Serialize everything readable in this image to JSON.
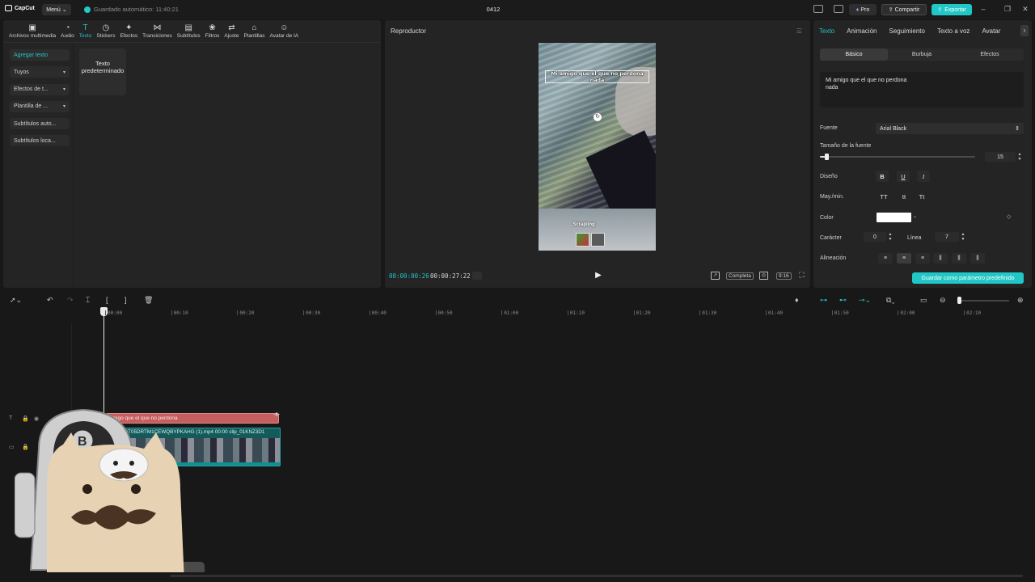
{
  "app": {
    "logo_text": "CapCut",
    "menu_label": "Menú",
    "autosave_text": "Guardado automático: 11:40:21",
    "project_title": "0412",
    "pro_label": "Pro",
    "share_label": "Compartir",
    "export_label": "Exportar",
    "accent_color": "#21c6c6"
  },
  "media": {
    "tabs": [
      {
        "label": "Archivos multimedia",
        "icon": "media-icon"
      },
      {
        "label": "Audio",
        "icon": "audio-icon"
      },
      {
        "label": "Texto",
        "icon": "text-icon"
      },
      {
        "label": "Stickers",
        "icon": "sticker-icon"
      },
      {
        "label": "Efectos",
        "icon": "effects-icon"
      },
      {
        "label": "Transiciones",
        "icon": "transition-icon"
      },
      {
        "label": "Subtítulos",
        "icon": "subtitle-icon"
      },
      {
        "label": "Filtros",
        "icon": "filter-icon"
      },
      {
        "label": "Ajuste",
        "icon": "adjust-icon"
      },
      {
        "label": "Plantillas",
        "icon": "template-icon"
      },
      {
        "label": "Avatar de IA",
        "icon": "ai-avatar-icon"
      }
    ],
    "active_tab": "Texto",
    "side_items": [
      {
        "label": "Agregar texto"
      },
      {
        "label": "Tuyos"
      },
      {
        "label": "Efectos de t..."
      },
      {
        "label": "Plantilla de ..."
      },
      {
        "label": "Subtítulos auto..."
      },
      {
        "label": "Subtítulos loca..."
      }
    ],
    "preset_card_label": "Texto predeterminado"
  },
  "player": {
    "title": "Reproductor",
    "overlay_text": "Mi amigo que el que no perdona nada",
    "video_caption": "Scrapling",
    "current_time": "00:00:00:26",
    "total_time": "00:00:27:22",
    "view_mode_label": "Completa",
    "ratio_label": "9:16"
  },
  "properties": {
    "tabs": [
      "Texto",
      "Animación",
      "Seguimiento",
      "Texto a voz",
      "Avatar"
    ],
    "active_tab": "Texto",
    "sub_tabs": [
      "Básico",
      "Burbuja",
      "Efectos"
    ],
    "active_sub_tab": "Básico",
    "text_content_line1": "Mi amigo que el que no perdona",
    "text_content_line2": "nada",
    "font_label": "Fuente",
    "font_value": "Arial Black",
    "size_label": "Tamaño de la fuente",
    "size_value": "15",
    "size_fraction": 0.04,
    "design_label": "Diseño",
    "case_label": "May./min.",
    "case_options": [
      "TT",
      "tt",
      "Tt"
    ],
    "color_label": "Color",
    "color_value": "#ffffff",
    "char_label": "Carácter",
    "char_value": "0",
    "line_label": "Línea",
    "line_value": "7",
    "align_label": "Alineación",
    "save_preset_label": "Guardar como parámetro predefinido"
  },
  "timeline": {
    "ruler_labels": [
      "00:00",
      "00:10",
      "00:20",
      "00:30",
      "00:40",
      "00:50",
      "01:00",
      "01:10",
      "01:20",
      "01:30",
      "01:40",
      "01:50",
      "02:00",
      "02:10"
    ],
    "text_clip_label": "amigo que el que no perdona",
    "video_clip_label1": "1KNZ3DT05DRTM1CEWQBYPKAHG (1).mp4",
    "video_clip_time": "00:00",
    "video_clip_label2": "clip_01KNZ3D1"
  }
}
